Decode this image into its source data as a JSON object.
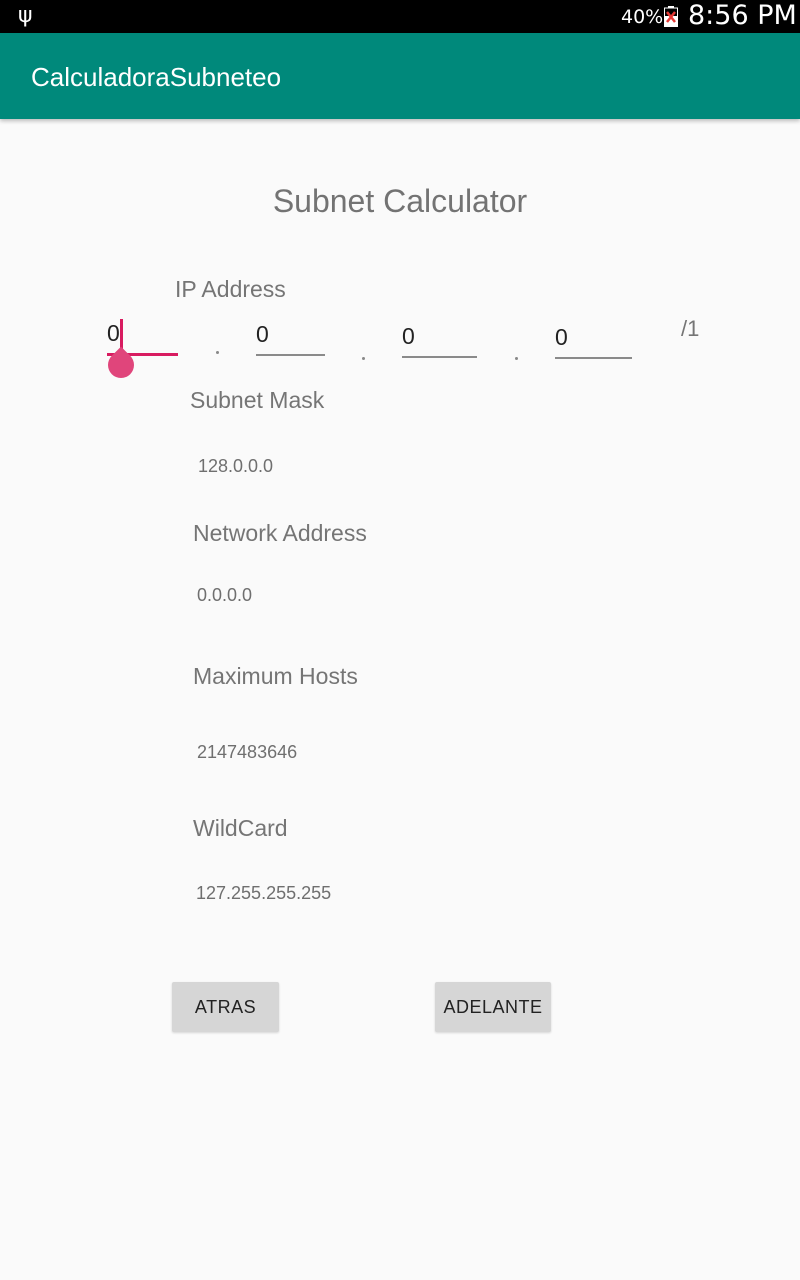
{
  "status_bar": {
    "usb_icon": "usb-icon",
    "battery_level": "40%",
    "time": "8:56 PM"
  },
  "app_bar": {
    "title": "CalculadoraSubneteo",
    "color": "#00897b"
  },
  "main": {
    "heading": "Subnet Calculator",
    "ip_label": "IP Address",
    "octets": [
      "0",
      "0",
      "0",
      "0"
    ],
    "prefix": "/1",
    "subnet_mask_label": "Subnet Mask",
    "subnet_mask_value": "128.0.0.0",
    "network_address_label": "Network Address",
    "network_address_value": "0.0.0.0",
    "max_hosts_label": "Maximum Hosts",
    "max_hosts_value": "2147483646",
    "wildcard_label": "WildCard",
    "wildcard_value": "127.255.255.255"
  },
  "buttons": {
    "back": "ATRAS",
    "forward": "ADELANTE"
  },
  "colors": {
    "accent": "#d81b60",
    "primary": "#00897b"
  }
}
